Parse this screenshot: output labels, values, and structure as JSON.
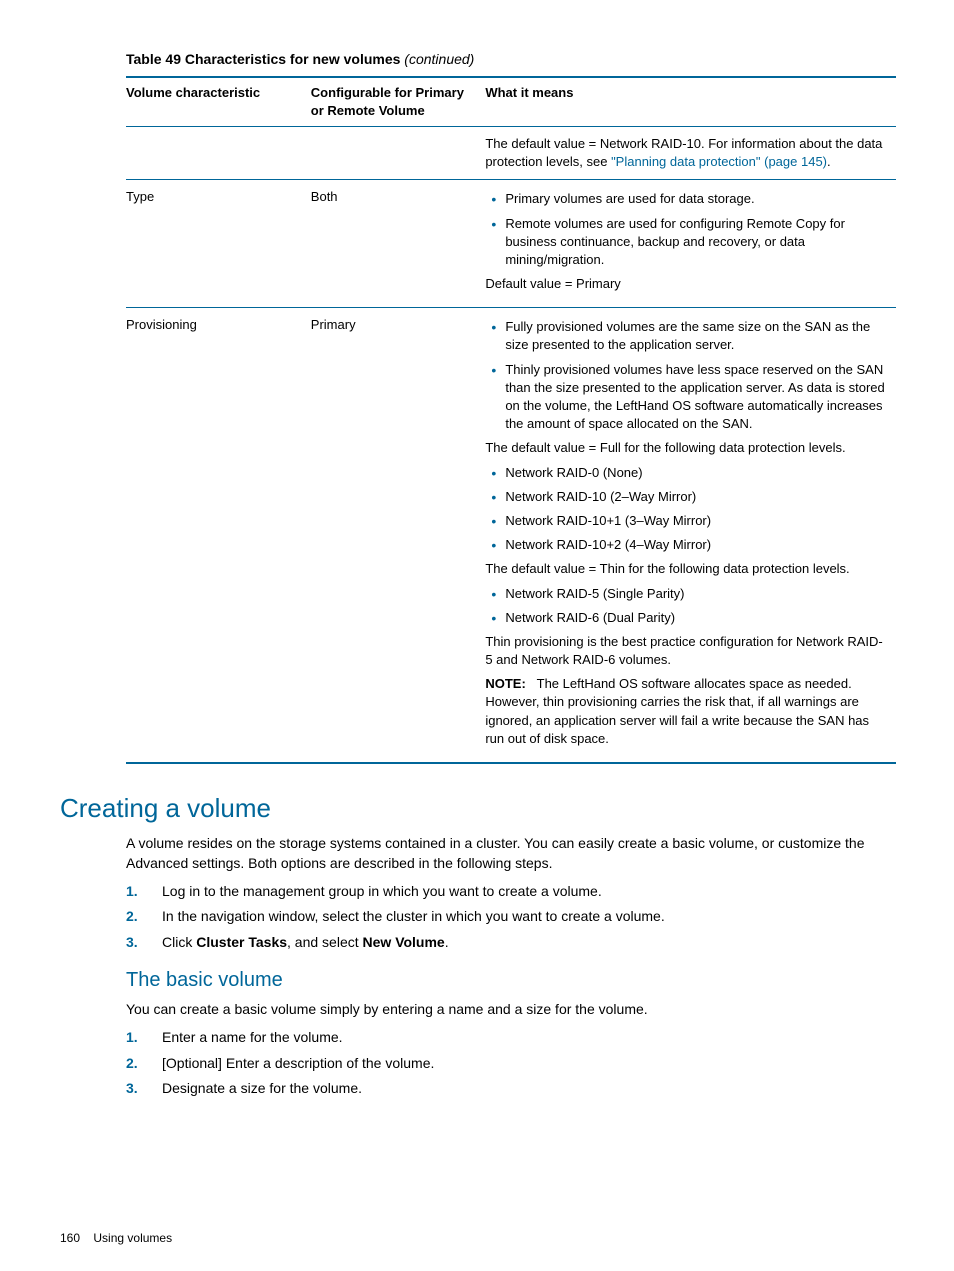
{
  "table": {
    "caption_prefix": "Table 49 Characteristics for new volumes ",
    "caption_suffix": "(continued)",
    "headers": [
      "Volume characteristic",
      "Configurable for Primary or Remote Volume",
      "What it means"
    ],
    "rows": [
      {
        "c1": "",
        "c2": "",
        "c3_para1_a": "The default value = Network RAID-10. For information about the data protection levels, see ",
        "c3_para1_link": "\"Planning data protection\" (page 145)",
        "c3_para1_b": "."
      },
      {
        "c1": "Type",
        "c2": "Both",
        "bullets": [
          "Primary volumes are used for data storage.",
          "Remote volumes are used for configuring Remote Copy for business continuance, backup and recovery, or data mining/migration."
        ],
        "trail": "Default value = Primary"
      },
      {
        "c1": "Provisioning",
        "c2": "Primary",
        "bullets1": [
          "Fully provisioned volumes are the same size on the SAN as the size presented to the application server.",
          "Thinly provisioned volumes have less space reserved on the SAN than the size presented to the application server. As data is stored on the volume, the LeftHand OS software automatically increases the amount of space allocated on the SAN."
        ],
        "para1": "The default value = Full for the following data protection levels.",
        "bullets2": [
          "Network RAID-0 (None)",
          "Network RAID-10 (2–Way Mirror)",
          "Network RAID-10+1 (3–Way Mirror)",
          "Network RAID-10+2 (4–Way Mirror)"
        ],
        "para2": "The default value = Thin for the following data protection levels.",
        "bullets3": [
          "Network RAID-5 (Single Parity)",
          "Network RAID-6 (Dual Parity)"
        ],
        "para3": "Thin provisioning is the best practice configuration for Network RAID-5 and Network RAID-6 volumes.",
        "note_label": "NOTE:",
        "note_text": "The LeftHand OS software allocates space as needed. However, thin provisioning carries the risk that, if all warnings are ignored, an application server will fail a write because the SAN has run out of disk space."
      }
    ]
  },
  "section1": {
    "title": "Creating a volume",
    "intro": "A volume resides on the storage systems contained in a cluster. You can easily create a basic volume, or customize the Advanced settings. Both options are described in the following steps.",
    "steps": [
      "Log in to the management group in which you want to create a volume.",
      "In the navigation window, select the cluster in which you want to create a volume."
    ],
    "step3_a": "Click ",
    "step3_b1": "Cluster Tasks",
    "step3_c": ", and select ",
    "step3_b2": "New Volume",
    "step3_d": "."
  },
  "section2": {
    "title": "The basic volume",
    "intro": "You can create a basic volume simply by entering a name and a size for the volume.",
    "steps": [
      "Enter a name for the volume.",
      "[Optional] Enter a description of the volume.",
      "Designate a size for the volume."
    ]
  },
  "footer": {
    "page": "160",
    "running": "Using volumes"
  }
}
